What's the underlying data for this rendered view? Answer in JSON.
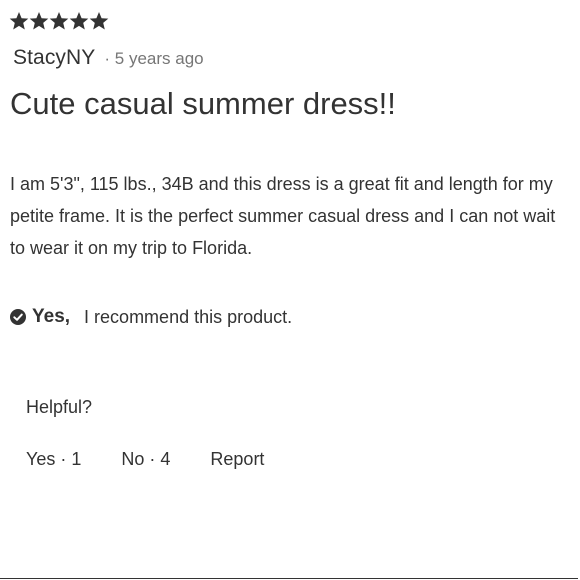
{
  "review": {
    "rating": {
      "value": 5,
      "max": 5,
      "icon": "star-icon"
    },
    "author": "StacyNY",
    "timestamp": "· 5 years ago",
    "title": "Cute casual summer dress!!",
    "body": "I am 5'3\", 115 lbs., 34B and this dress is a great fit and length for my petite frame. It is the perfect summer casual dress and I can not wait to wear it on my trip to Florida.",
    "recommendation": {
      "icon": "check-circle-icon",
      "answer": "Yes,",
      "text": "I recommend this product."
    },
    "helpful": {
      "prompt": "Helpful?",
      "yes_label": "Yes · 1",
      "no_label": "No · 4",
      "report_label": "Report"
    }
  },
  "colors": {
    "text": "#333333",
    "muted": "#767676",
    "star": "#333333"
  }
}
